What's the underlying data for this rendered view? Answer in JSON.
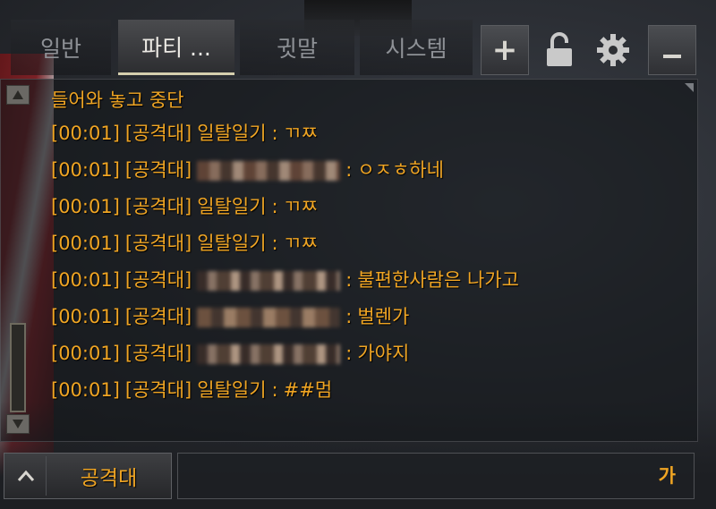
{
  "tabs": [
    {
      "label": "일반",
      "active": false
    },
    {
      "label": "파티 ...",
      "active": true
    },
    {
      "label": "귓말",
      "active": false
    },
    {
      "label": "시스템",
      "active": false
    }
  ],
  "toolbar": {
    "add_label": "+"
  },
  "colors": {
    "message_text": "#f0a523",
    "active_tab_underline": "#d5cfae"
  },
  "chat": {
    "header": "들어와 놓고 중단",
    "messages": [
      {
        "time": "[00:01]",
        "channel": "[공격대]",
        "sender": "일탈일기",
        "sep": ":",
        "text": "ㄲㅉ",
        "sender_hidden": false
      },
      {
        "time": "[00:01]",
        "channel": "[공격대]",
        "sender": "",
        "sep": ":",
        "text": "ㅇㅈㅎ하네",
        "sender_hidden": true
      },
      {
        "time": "[00:01]",
        "channel": "[공격대]",
        "sender": "일탈일기",
        "sep": ":",
        "text": "ㄲㅉ",
        "sender_hidden": false
      },
      {
        "time": "[00:01]",
        "channel": "[공격대]",
        "sender": "일탈일기",
        "sep": ":",
        "text": "ㄲㅉ",
        "sender_hidden": false
      },
      {
        "time": "[00:01]",
        "channel": "[공격대]",
        "sender": "",
        "sep": ":",
        "text": "불편한사람은 나가고",
        "sender_hidden": true
      },
      {
        "time": "[00:01]",
        "channel": "[공격대]",
        "sender": "",
        "sep": ":",
        "text": "벌렌가",
        "sender_hidden": true
      },
      {
        "time": "[00:01]",
        "channel": "[공격대]",
        "sender": "",
        "sep": ":",
        "text": "가야지",
        "sender_hidden": true
      },
      {
        "time": "[00:01]",
        "channel": "[공격대]",
        "sender": "일탈일기",
        "sep": ":",
        "text": "##멈",
        "sender_hidden": false
      }
    ]
  },
  "input": {
    "channel": "공격대",
    "ime_mode": "가",
    "value": ""
  }
}
